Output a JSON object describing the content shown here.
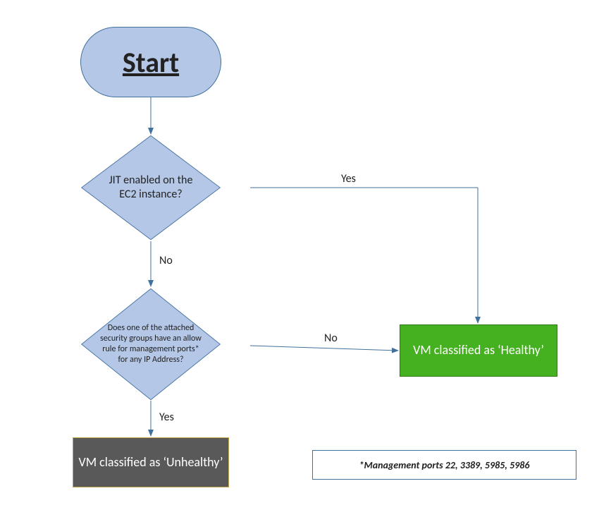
{
  "nodes": {
    "start": "Start",
    "decision1": "JIT enabled on the EC2 instance?",
    "decision2": "Does one of the attached security groups have an allow rule for management ports* for any IP Address?",
    "healthy": "VM classified as ‘Healthy’",
    "unhealthy": "VM classified as ‘Unhealthy’",
    "footnote": "*Management ports 22, 3389, 5985, 5986"
  },
  "edges": {
    "d1_yes": "Yes",
    "d1_no": "No",
    "d2_no": "No",
    "d2_yes": "Yes"
  }
}
